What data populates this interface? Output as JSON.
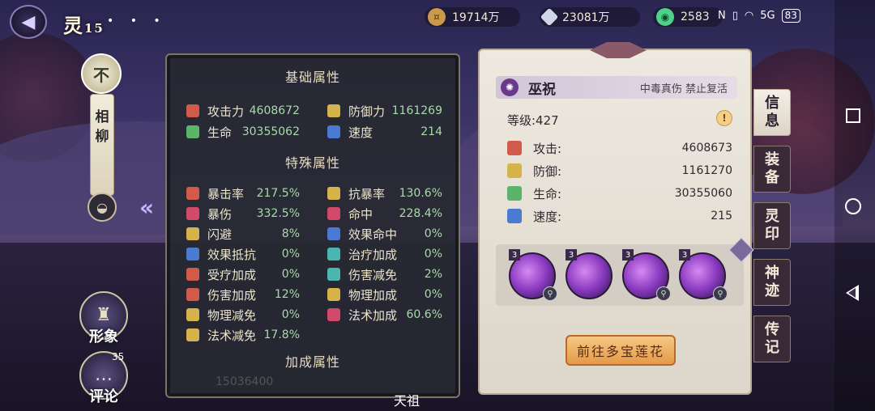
{
  "header": {
    "title": "灵",
    "level_badge": "15",
    "menu_dots": "• • •",
    "resources": [
      {
        "icon": "coin-icon",
        "value": "19714万"
      },
      {
        "icon": "crystal-icon",
        "value": "23081万"
      },
      {
        "icon": "jade-icon",
        "value": "2583"
      }
    ],
    "status": {
      "nfc": "N",
      "signal": "5G",
      "battery": "83"
    }
  },
  "character": {
    "emblem": "不",
    "name_chars": [
      "相",
      "柳"
    ],
    "buttons": {
      "appearance": "形象",
      "comments": "评论"
    },
    "comment_count": "35"
  },
  "stats": {
    "basic_title": "基础属性",
    "basic": [
      {
        "name": "攻击力",
        "value": "4608672",
        "icon": "attack-icon",
        "color": "red"
      },
      {
        "name": "防御力",
        "value": "1161269",
        "icon": "defense-icon",
        "color": "gold"
      },
      {
        "name": "生命",
        "value": "30355062",
        "icon": "hp-icon",
        "color": "green"
      },
      {
        "name": "速度",
        "value": "214",
        "icon": "speed-icon",
        "color": "blue"
      }
    ],
    "special_title": "特殊属性",
    "special": [
      {
        "name": "暴击率",
        "value": "217.5%",
        "icon": "crit-rate-icon",
        "color": "red"
      },
      {
        "name": "抗暴率",
        "value": "130.6%",
        "icon": "crit-resist-icon",
        "color": "gold"
      },
      {
        "name": "暴伤",
        "value": "332.5%",
        "icon": "crit-damage-icon",
        "color": "pink"
      },
      {
        "name": "命中",
        "value": "228.4%",
        "icon": "accuracy-icon",
        "color": "pink"
      },
      {
        "name": "闪避",
        "value": "8%",
        "icon": "dodge-icon",
        "color": "gold"
      },
      {
        "name": "效果命中",
        "value": "0%",
        "icon": "effect-hit-icon",
        "color": "blue"
      },
      {
        "name": "效果抵抗",
        "value": "0%",
        "icon": "effect-resist-icon",
        "color": "blue"
      },
      {
        "name": "治疗加成",
        "value": "0%",
        "icon": "heal-bonus-icon",
        "color": "teal"
      },
      {
        "name": "受疗加成",
        "value": "0%",
        "icon": "heal-received-icon",
        "color": "red"
      },
      {
        "name": "伤害减免",
        "value": "2%",
        "icon": "damage-reduction-icon",
        "color": "teal"
      },
      {
        "name": "伤害加成",
        "value": "12%",
        "icon": "damage-bonus-icon",
        "color": "red"
      },
      {
        "name": "物理加成",
        "value": "0%",
        "icon": "physical-bonus-icon",
        "color": "gold"
      },
      {
        "name": "物理减免",
        "value": "0%",
        "icon": "physical-reduction-icon",
        "color": "gold"
      },
      {
        "name": "法术加成",
        "value": "60.6%",
        "icon": "magic-bonus-icon",
        "color": "pink"
      },
      {
        "name": "法术减免",
        "value": "17.8%",
        "icon": "magic-reduction-icon",
        "color": "gold"
      }
    ],
    "bonus_title": "加成属性",
    "bonus_faded": "15036400"
  },
  "detail": {
    "skill_name": "巫祝",
    "tags": "中毒真伤 禁止复活",
    "level_label": "等级:427",
    "rows": [
      {
        "name": "攻击:",
        "value": "4608673",
        "icon": "attack-icon",
        "color": "red"
      },
      {
        "name": "防御:",
        "value": "1161270",
        "icon": "defense-icon",
        "color": "gold"
      },
      {
        "name": "生命:",
        "value": "30355060",
        "icon": "hp-icon",
        "color": "green"
      },
      {
        "name": "速度:",
        "value": "215",
        "icon": "speed-icon",
        "color": "blue"
      }
    ],
    "skills": [
      {
        "level": "3"
      },
      {
        "level": "3"
      },
      {
        "level": "3"
      },
      {
        "level": "3"
      }
    ],
    "go_button": "前往多宝莲花"
  },
  "tabs": [
    {
      "label": [
        "信",
        "息"
      ],
      "active": true
    },
    {
      "label": [
        "装",
        "备"
      ],
      "active": false
    },
    {
      "label": [
        "灵",
        "印"
      ],
      "active": false
    },
    {
      "label": [
        "神",
        "迹"
      ],
      "active": false
    },
    {
      "label": [
        "传",
        "记"
      ],
      "active": false
    }
  ],
  "bottom_label": "天祖"
}
